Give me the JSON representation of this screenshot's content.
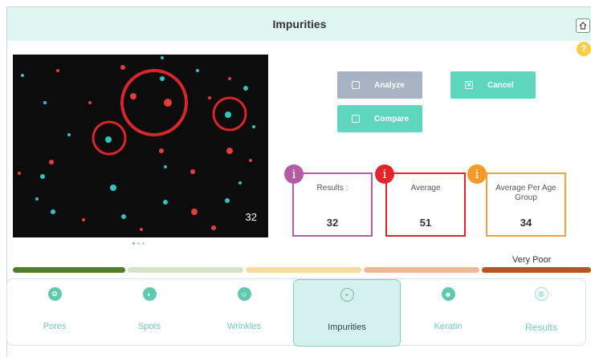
{
  "header": {
    "title": "Impurities"
  },
  "image_panel": {
    "count_overlay": "32"
  },
  "buttons": {
    "analyze": "Analyze",
    "cancel": "Cancel",
    "compare": "Compare"
  },
  "stats": {
    "results": {
      "label": "Results :",
      "value": "32",
      "color": "#b35ba3"
    },
    "average": {
      "label": "Average",
      "value": "51",
      "color": "#e1262b"
    },
    "age_group": {
      "label": "Average Per Age Group",
      "value": "34",
      "color": "#f4a13a"
    }
  },
  "rating": {
    "label": "Very Poor",
    "scale_colors": [
      "#4f7c2f",
      "#d4e3c6",
      "#f6dca0",
      "#f0b996",
      "#b6551e"
    ]
  },
  "nav": {
    "items": [
      {
        "label": "Pores",
        "icon": "pores-icon"
      },
      {
        "label": "Spots",
        "icon": "spots-icon"
      },
      {
        "label": "Wrinkles",
        "icon": "wrinkles-icon"
      },
      {
        "label": "Impurities",
        "icon": "impurities-icon",
        "active": true
      },
      {
        "label": "Keratin",
        "icon": "keratin-icon"
      },
      {
        "label": "Results",
        "icon": "results-icon"
      }
    ]
  },
  "colors": {
    "accent": "#5fd6be",
    "header_bg": "#dff6f3",
    "active_tab": "#d5f1ef"
  }
}
